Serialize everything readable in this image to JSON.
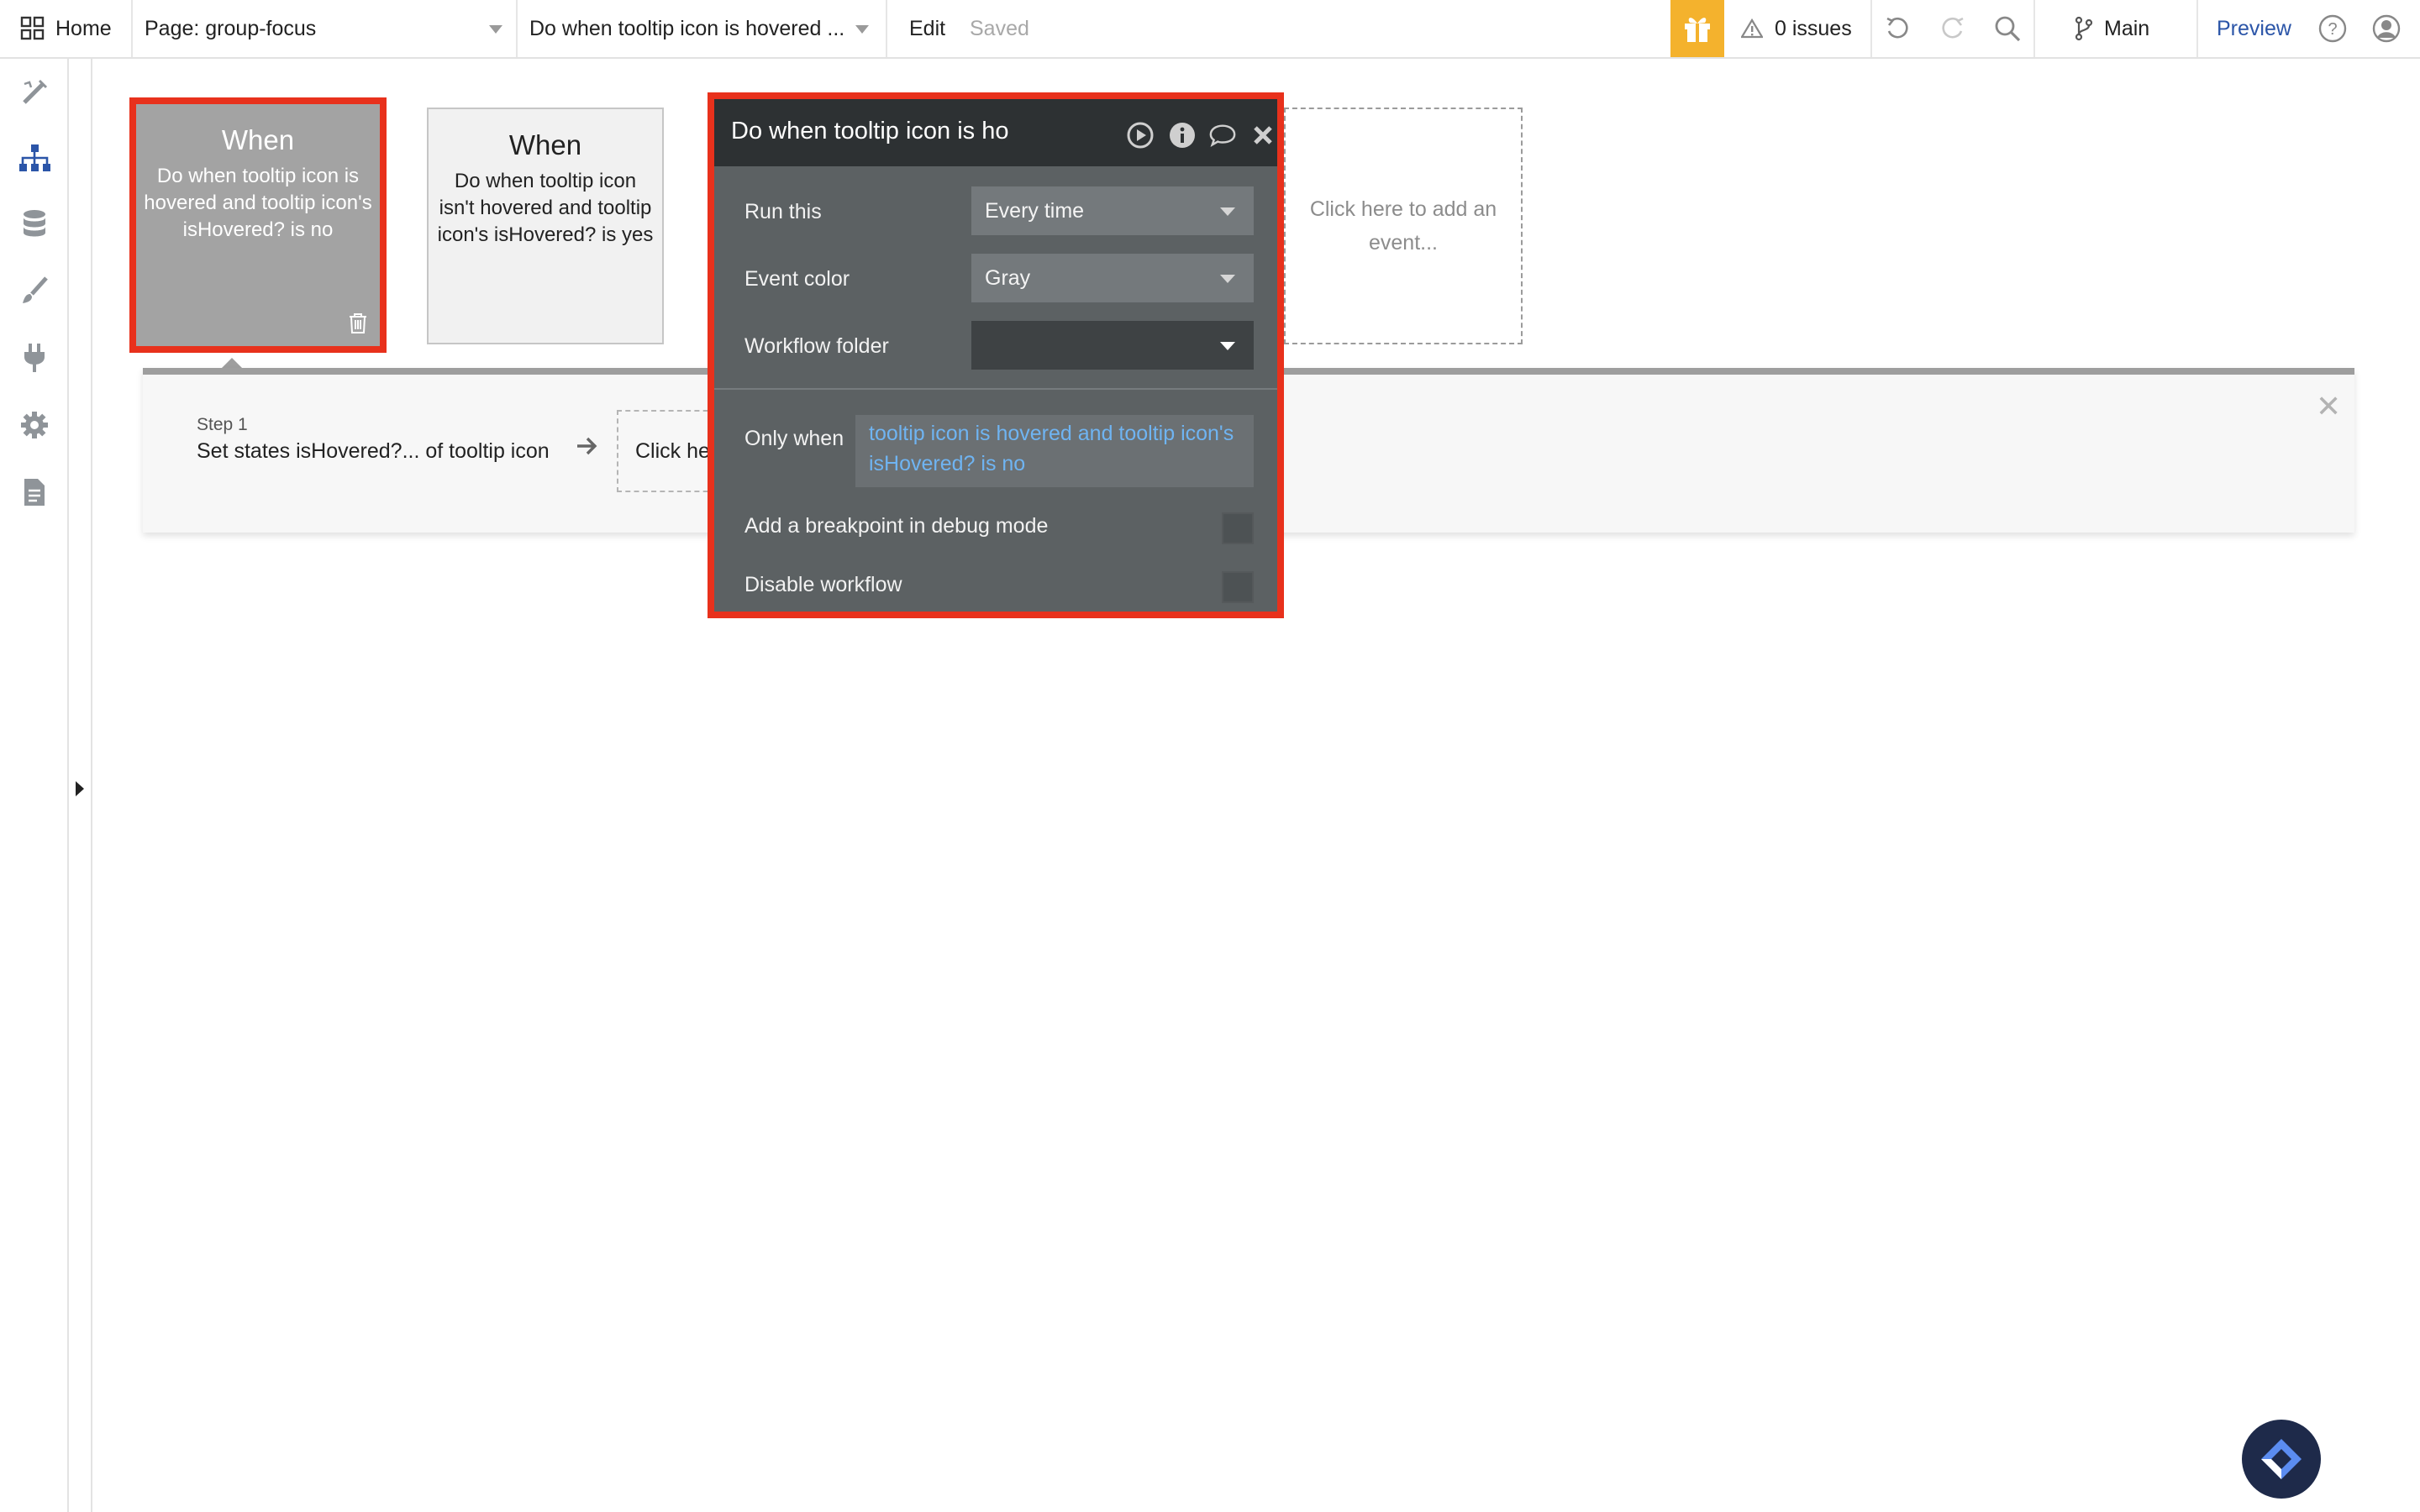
{
  "topbar": {
    "home_label": "Home",
    "page_selector": "Page: group-focus",
    "workflow_selector": "Do when tooltip icon is hovered ...",
    "edit_label": "Edit",
    "save_status": "Saved",
    "issues": "0 issues",
    "branch": "Main",
    "preview": "Preview"
  },
  "sidebar": {
    "icons": [
      "design-icon",
      "workflow-icon",
      "data-icon",
      "styles-icon",
      "plugins-icon",
      "settings-icon",
      "logs-icon"
    ]
  },
  "events": [
    {
      "title": "When",
      "description": "Do when tooltip icon is hovered and tooltip icon's isHovered? is no"
    },
    {
      "title": "When",
      "description": "Do when tooltip icon isn't hovered and tooltip icon's isHovered? is yes"
    }
  ],
  "add_event": "Click here to add an event...",
  "workflow": {
    "step_number": "Step 1",
    "step_name": "Set states isHovered?... of tooltip icon",
    "add_action": "Click here to add an action..."
  },
  "editor": {
    "title": "Do when tooltip icon is hovered",
    "run_this_label": "Run this",
    "run_this_value": "Every time",
    "event_color_label": "Event color",
    "event_color_value": "Gray",
    "folder_label": "Workflow folder",
    "folder_value": "",
    "only_when_label": "Only when",
    "only_when_value": "tooltip icon is hovered and tooltip icon's isHovered? is no",
    "breakpoint_label": "Add a breakpoint in debug mode",
    "disable_label": "Disable workflow"
  },
  "colors": {
    "accent_red": "#e8311c",
    "gift_yellow": "#f4b22d",
    "preview_blue": "#2b55a8",
    "condition_blue": "#6fb4f2"
  }
}
